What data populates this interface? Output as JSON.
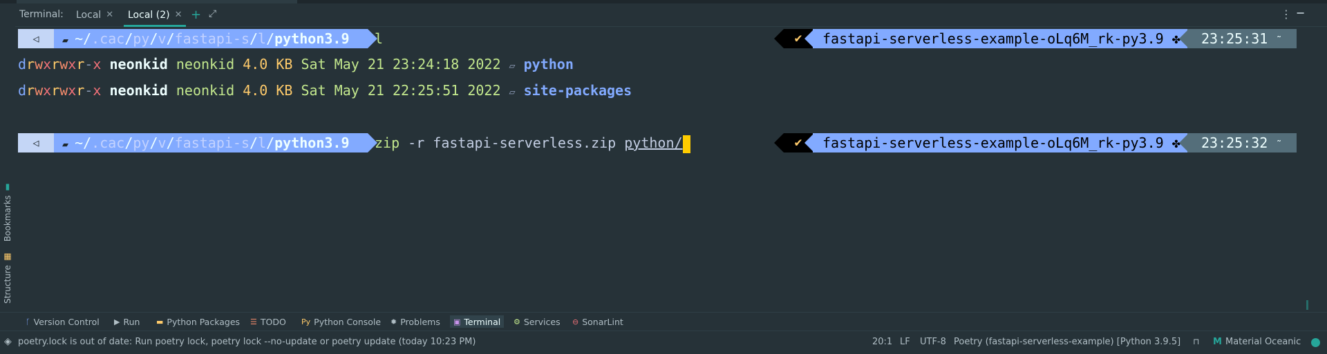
{
  "tab_bar": {
    "label": "Terminal:",
    "tabs": [
      {
        "label": "Local",
        "active": false
      },
      {
        "label": "Local (2)",
        "active": true
      }
    ],
    "add_icon": "plus-icon",
    "expand_icon": "expand-icon",
    "menu_icon": "kebab-menu-icon",
    "minimize_icon": "minimize-icon"
  },
  "terminal": {
    "prompt1": {
      "path_home": "~/",
      "path_dim": ".cac/py/v/fastapi-s/l/",
      "path_parts": [
        "~",
        ".cac",
        "py",
        "v",
        "fastapi-s",
        "l"
      ],
      "path_bold": "python3.9",
      "command": "l",
      "env": "fastapi-serverless-example-oLq6M_rk-py3.9",
      "time": "23:25:31",
      "status": "✔"
    },
    "listing": [
      {
        "perm": "drwxrwxr-x",
        "owner": "neonkid",
        "group": "neonkid",
        "size": "4.0 KB",
        "date": "Sat May 21 23:24:18 2022",
        "name": "python"
      },
      {
        "perm": "drwxrwxr-x",
        "owner": "neonkid",
        "group": "neonkid",
        "size": "4.0 KB",
        "date": "Sat May 21 22:25:51 2022",
        "name": "site-packages"
      }
    ],
    "prompt2": {
      "path_bold": "python3.9",
      "cmd_word": "zip",
      "cmd_args": "-r fastapi-serverless.zip",
      "cmd_path": "python/",
      "env": "fastapi-serverless-example-oLq6M_rk-py3.9",
      "time": "23:25:32",
      "status": "✔"
    }
  },
  "sidebar": {
    "items": [
      {
        "label": "Bookmarks",
        "icon": "bookmark-icon"
      },
      {
        "label": "Structure",
        "icon": "structure-icon"
      }
    ]
  },
  "toolbar": {
    "items": [
      {
        "label": "Version Control",
        "icon": "branch-icon"
      },
      {
        "label": "Run",
        "icon": "play-icon"
      },
      {
        "label": "Python Packages",
        "icon": "package-icon"
      },
      {
        "label": "TODO",
        "icon": "todo-icon"
      },
      {
        "label": "Python Console",
        "icon": "python-icon"
      },
      {
        "label": "Problems",
        "icon": "bug-icon"
      },
      {
        "label": "Terminal",
        "icon": "terminal-icon"
      },
      {
        "label": "Services",
        "icon": "gear-icon"
      },
      {
        "label": "SonarLint",
        "icon": "sonarlint-icon"
      }
    ],
    "active": "Terminal"
  },
  "statusbar": {
    "message": "poetry.lock is out of date: Run poetry lock, poetry lock --no-update or poetry update (today 10:23 PM)",
    "position": "20:1",
    "line_ending": "LF",
    "encoding": "UTF-8",
    "interpreter": "Poetry (fastapi-serverless-example) [Python 3.9.5]",
    "theme": "Material Oceanic"
  },
  "colors": {
    "background": "#263238",
    "accent": "#26a69a",
    "prompt_blue": "#82aaff",
    "green": "#c3e88d",
    "yellow": "#ffcb6b"
  }
}
